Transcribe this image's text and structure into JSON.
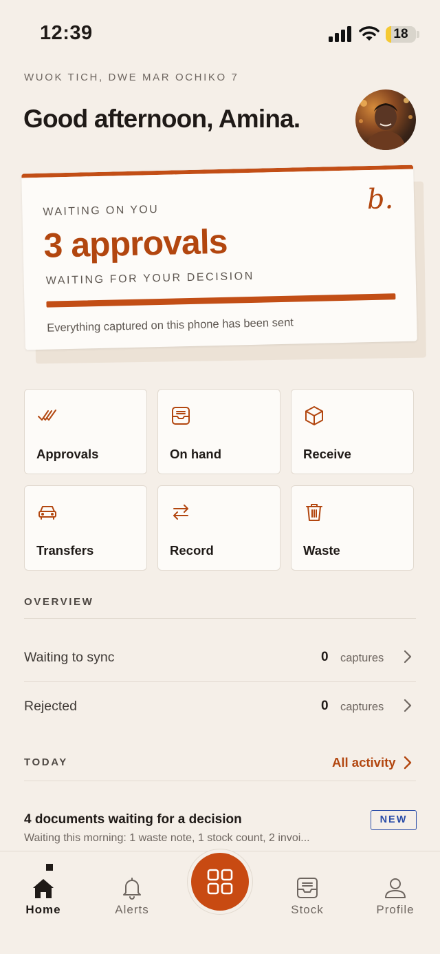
{
  "status_bar": {
    "time": "12:39",
    "battery": "18",
    "battery_level": 0.18
  },
  "header": {
    "date": "WUOK TICH, DWE MAR OCHIKO 7",
    "greeting": "Good afternoon, Amina."
  },
  "card": {
    "kicker": "WAITING ON YOU",
    "logo": "b.",
    "title": "3 approvals",
    "subtitle": "WAITING FOR YOUR DECISION",
    "note": "Everything captured on this phone has been sent",
    "accent": "#c24e16"
  },
  "actions": [
    {
      "label": "Approvals",
      "icon": "double-check-icon"
    },
    {
      "label": "On hand",
      "icon": "inbox-tray-icon"
    },
    {
      "label": "Receive",
      "icon": "box-icon"
    },
    {
      "label": "Transfers",
      "icon": "car-icon"
    },
    {
      "label": "Record",
      "icon": "swap-arrows-icon"
    },
    {
      "label": "Waste",
      "icon": "trash-icon"
    }
  ],
  "overview": {
    "label": "OVERVIEW",
    "rows": [
      {
        "label": "Waiting to sync",
        "count": "0",
        "unit": "captures"
      },
      {
        "label": "Rejected",
        "count": "0",
        "unit": "captures"
      }
    ]
  },
  "today": {
    "label": "TODAY",
    "link": "All activity",
    "item_title": "4 documents waiting for a decision",
    "item_sub": "Waiting this morning: 1 waste note, 1 stock count, 2 invoi...",
    "badge": "NEW"
  },
  "tabs": [
    {
      "label": "Home",
      "icon": "home-icon"
    },
    {
      "label": "Alerts",
      "icon": "bell-icon"
    },
    {
      "label": "Stock",
      "icon": "inbox-tray-icon"
    },
    {
      "label": "Profile",
      "icon": "person-icon"
    }
  ],
  "colors": {
    "accent": "#c24e16",
    "background": "#f5efe8",
    "badge": "#2a4da8"
  }
}
